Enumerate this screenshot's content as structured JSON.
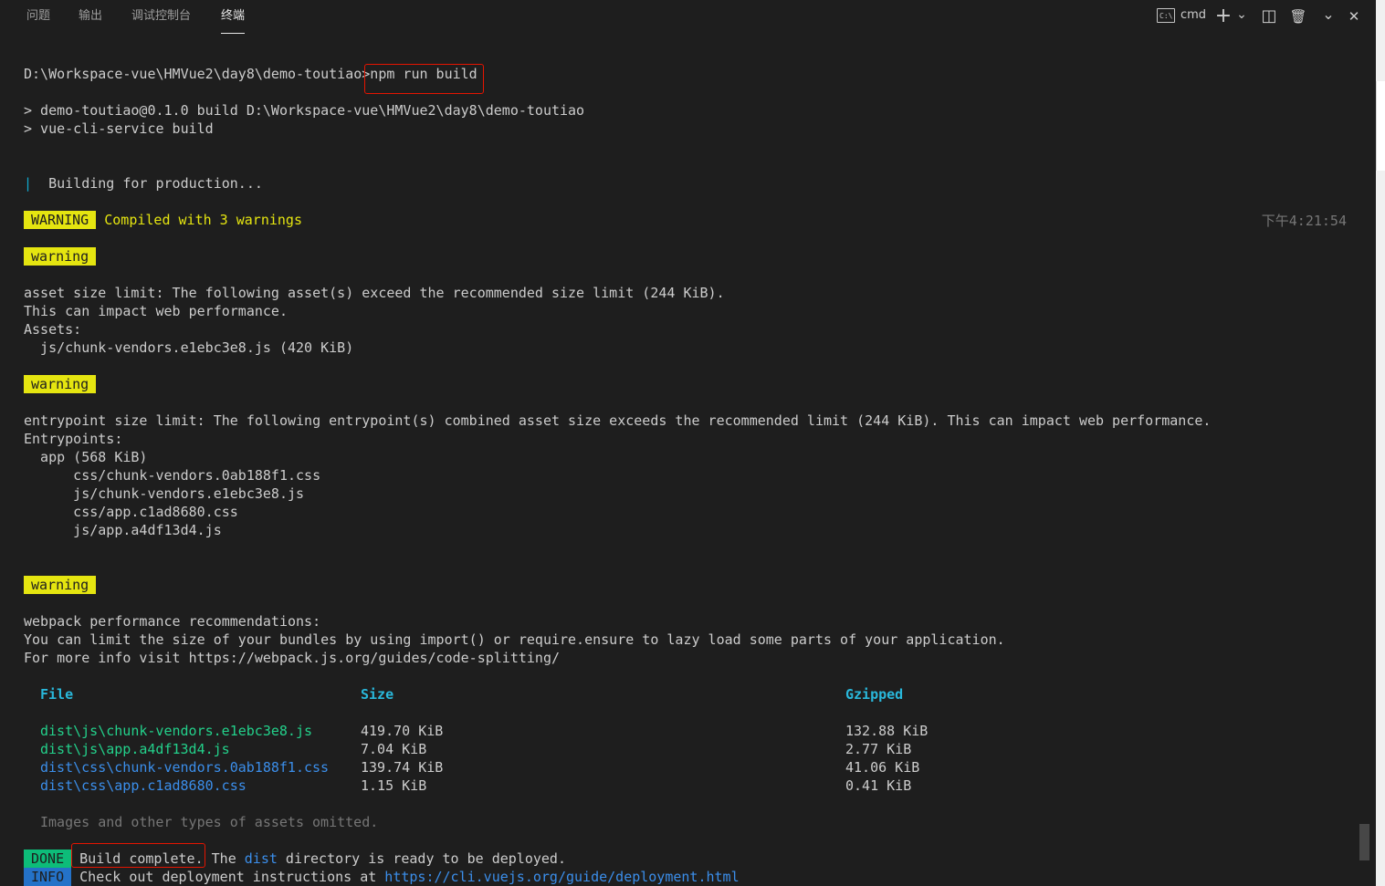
{
  "tabs": [
    {
      "label": "问题"
    },
    {
      "label": "输出"
    },
    {
      "label": "调试控制台"
    },
    {
      "label": "终端",
      "active": true
    }
  ],
  "toolbar": {
    "shell_icon_text": "C:\\",
    "shell_name": "cmd",
    "new_terminal_icon": "plus-icon",
    "dropdown_icon": "chevron-down-icon",
    "split_icon": "split-icon",
    "trash_icon": "trash-icon",
    "maximize_icon": "chevron-down-icon",
    "close_icon": "close-icon",
    "plus_glyph": "+",
    "chevron_glyph": "⌄",
    "split_glyph": "◫",
    "trash_glyph": "🗑",
    "close_glyph": "✕"
  },
  "terminal": {
    "prompt": "D:\\Workspace-vue\\HMVue2\\day8\\demo-toutiao>",
    "command": "npm run build",
    "script_line1": "> demo-toutiao@0.1.0 build D:\\Workspace-vue\\HMVue2\\day8\\demo-toutiao",
    "script_line2": "> vue-cli-service build",
    "spinner": "|",
    "building": "Building for production...",
    "warning_badge": "WARNING",
    "compiled_msg": "Compiled with 3 warnings",
    "time": "下午4:21:54",
    "warn1_badge": "warning",
    "warn1_l1": "asset size limit: The following asset(s) exceed the recommended size limit (244 KiB).",
    "warn1_l2": "This can impact web performance.",
    "warn1_l3": "Assets:",
    "warn1_l4": "  js/chunk-vendors.e1ebc3e8.js (420 KiB)",
    "warn2_badge": "warning",
    "warn2_l1": "entrypoint size limit: The following entrypoint(s) combined asset size exceeds the recommended limit (244 KiB). This can impact web performance.",
    "warn2_l2": "Entrypoints:",
    "warn2_l3": "  app (568 KiB)",
    "warn2_l4": "      css/chunk-vendors.0ab188f1.css",
    "warn2_l5": "      js/chunk-vendors.e1ebc3e8.js",
    "warn2_l6": "      css/app.c1ad8680.css",
    "warn2_l7": "      js/app.a4df13d4.js",
    "warn3_badge": "warning",
    "warn3_l1": "webpack performance recommendations:",
    "warn3_l2": "You can limit the size of your bundles by using import() or require.ensure to lazy load some parts of your application.",
    "warn3_l3": "For more info visit https://webpack.js.org/guides/code-splitting/",
    "table_headers": {
      "file": "File",
      "size": "Size",
      "gzipped": "Gzipped"
    },
    "files": [
      {
        "name": "dist\\js\\chunk-vendors.e1ebc3e8.js",
        "size": "419.70 KiB",
        "gzip": "132.88 KiB",
        "color": "#23d18b"
      },
      {
        "name": "dist\\js\\app.a4df13d4.js",
        "size": "7.04 KiB",
        "gzip": "2.77 KiB",
        "color": "#23d18b"
      },
      {
        "name": "dist\\css\\chunk-vendors.0ab188f1.css",
        "size": "139.74 KiB",
        "gzip": "41.06 KiB",
        "color": "#3b8eea"
      },
      {
        "name": "dist\\css\\app.c1ad8680.css",
        "size": "1.15 KiB",
        "gzip": "0.41 KiB",
        "color": "#3b8eea"
      }
    ],
    "omitted": "Images and other types of assets omitted.",
    "done_badge": "DONE",
    "done_msg": "Build complete.",
    "done_rest1": " The ",
    "done_dist": "dist",
    "done_rest2": " directory is ready to be deployed.",
    "info_badge": "INFO",
    "info_msg": "Check out deployment instructions at ",
    "info_link": "https://cli.vuejs.org/guide/deployment.html"
  }
}
